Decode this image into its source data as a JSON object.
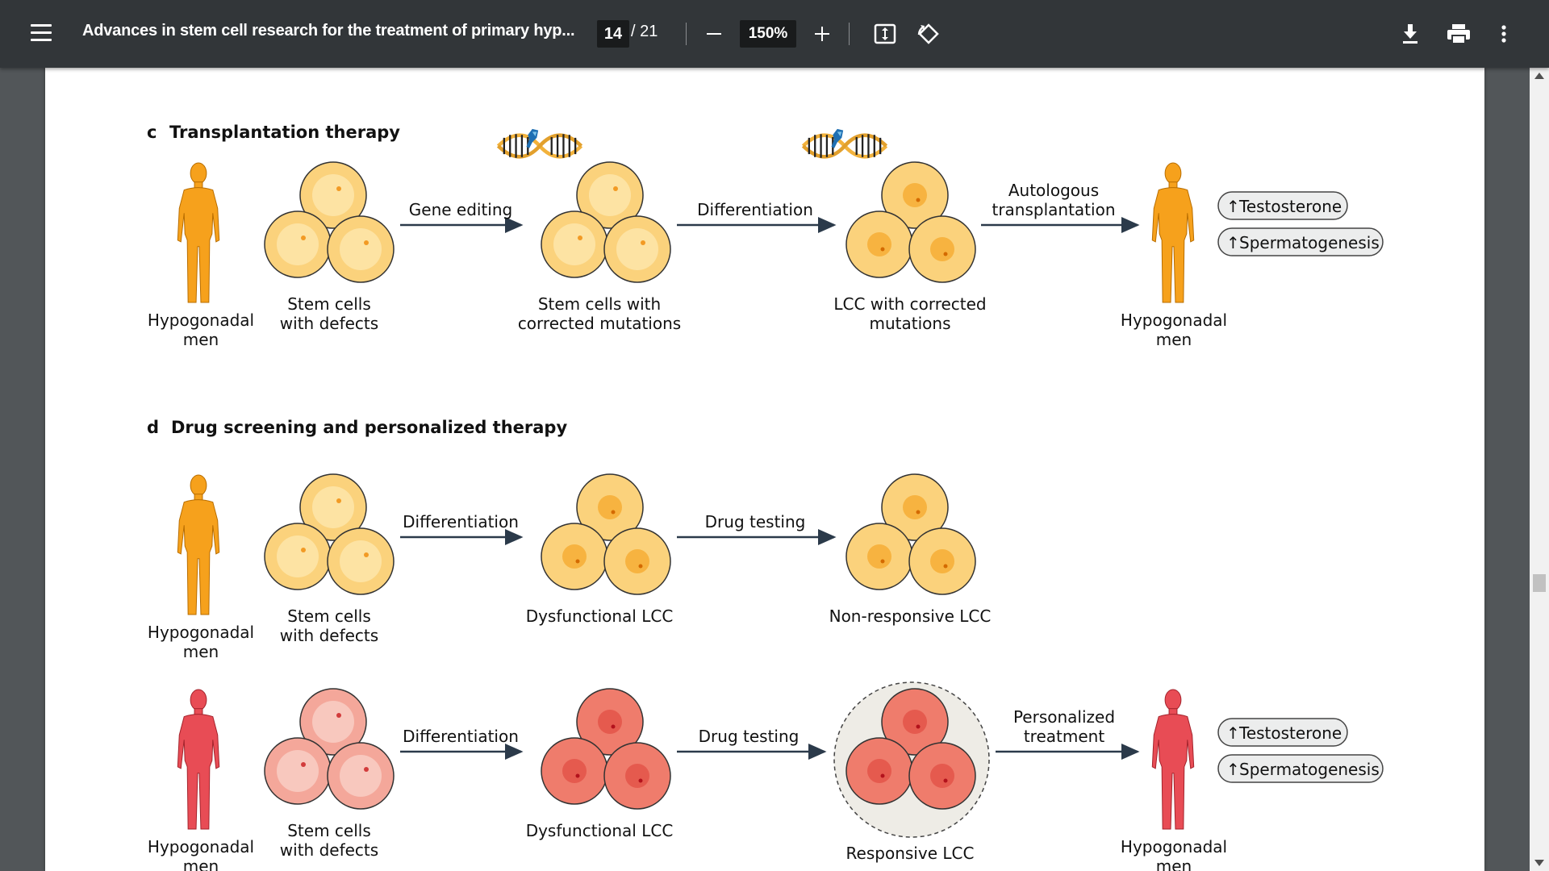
{
  "toolbar": {
    "menu_icon": "hamburger-menu-icon",
    "title": "Advances in stem cell research for the treatment of primary hyp...",
    "page_current": "14",
    "page_total": "/ 21",
    "zoom": "150%",
    "icons": [
      "minus-icon",
      "plus-icon",
      "fit-page-icon",
      "rotate-icon",
      "download-icon",
      "print-icon",
      "more-vert-icon"
    ]
  },
  "figure": {
    "panel_c": {
      "letter": "c",
      "title": "Transplantation therapy",
      "men_left": [
        "Hypogonadal",
        "men"
      ],
      "stem": [
        "Stem cells",
        "with defects"
      ],
      "arrow1": "Gene editing",
      "corrected": [
        "Stem cells with",
        "corrected mutations"
      ],
      "arrow2": "Differentiation",
      "lcc": [
        "LCC with corrected",
        "mutations"
      ],
      "arrow3": [
        "Autologous",
        "transplantation"
      ],
      "men_right": [
        "Hypogonadal",
        "men"
      ],
      "badge1": "Testosterone",
      "badge2": "Spermatogenesis"
    },
    "panel_d": {
      "letter": "d",
      "title": "Drug screening and personalized therapy",
      "row1": {
        "men": [
          "Hypogonadal",
          "men"
        ],
        "stem": [
          "Stem cells",
          "with defects"
        ],
        "arrow1": "Differentiation",
        "lcc": "Dysfunctional LCC",
        "arrow2": "Drug testing",
        "result": "Non-responsive LCC"
      },
      "row2": {
        "men": [
          "Hypogonadal",
          "men"
        ],
        "stem": [
          "Stem cells",
          "with defects"
        ],
        "arrow1": "Differentiation",
        "lcc": "Dysfunctional LCC",
        "arrow2": "Drug testing",
        "result": "Responsive LCC",
        "arrow3": [
          "Personalized",
          "treatment"
        ],
        "men_right": [
          "Hypogonadal",
          "men"
        ],
        "badge1": "Testosterone",
        "badge2": "Spermatogenesis"
      }
    }
  },
  "colors": {
    "toolbar_bg": "#323639",
    "viewer_bg": "#525659",
    "orange_figure": "#f6a11c",
    "red_figure": "#e84c55",
    "cell_orange": "#fbd27c",
    "cell_red": "#f08a7a",
    "arrow": "#2b3a4a"
  }
}
